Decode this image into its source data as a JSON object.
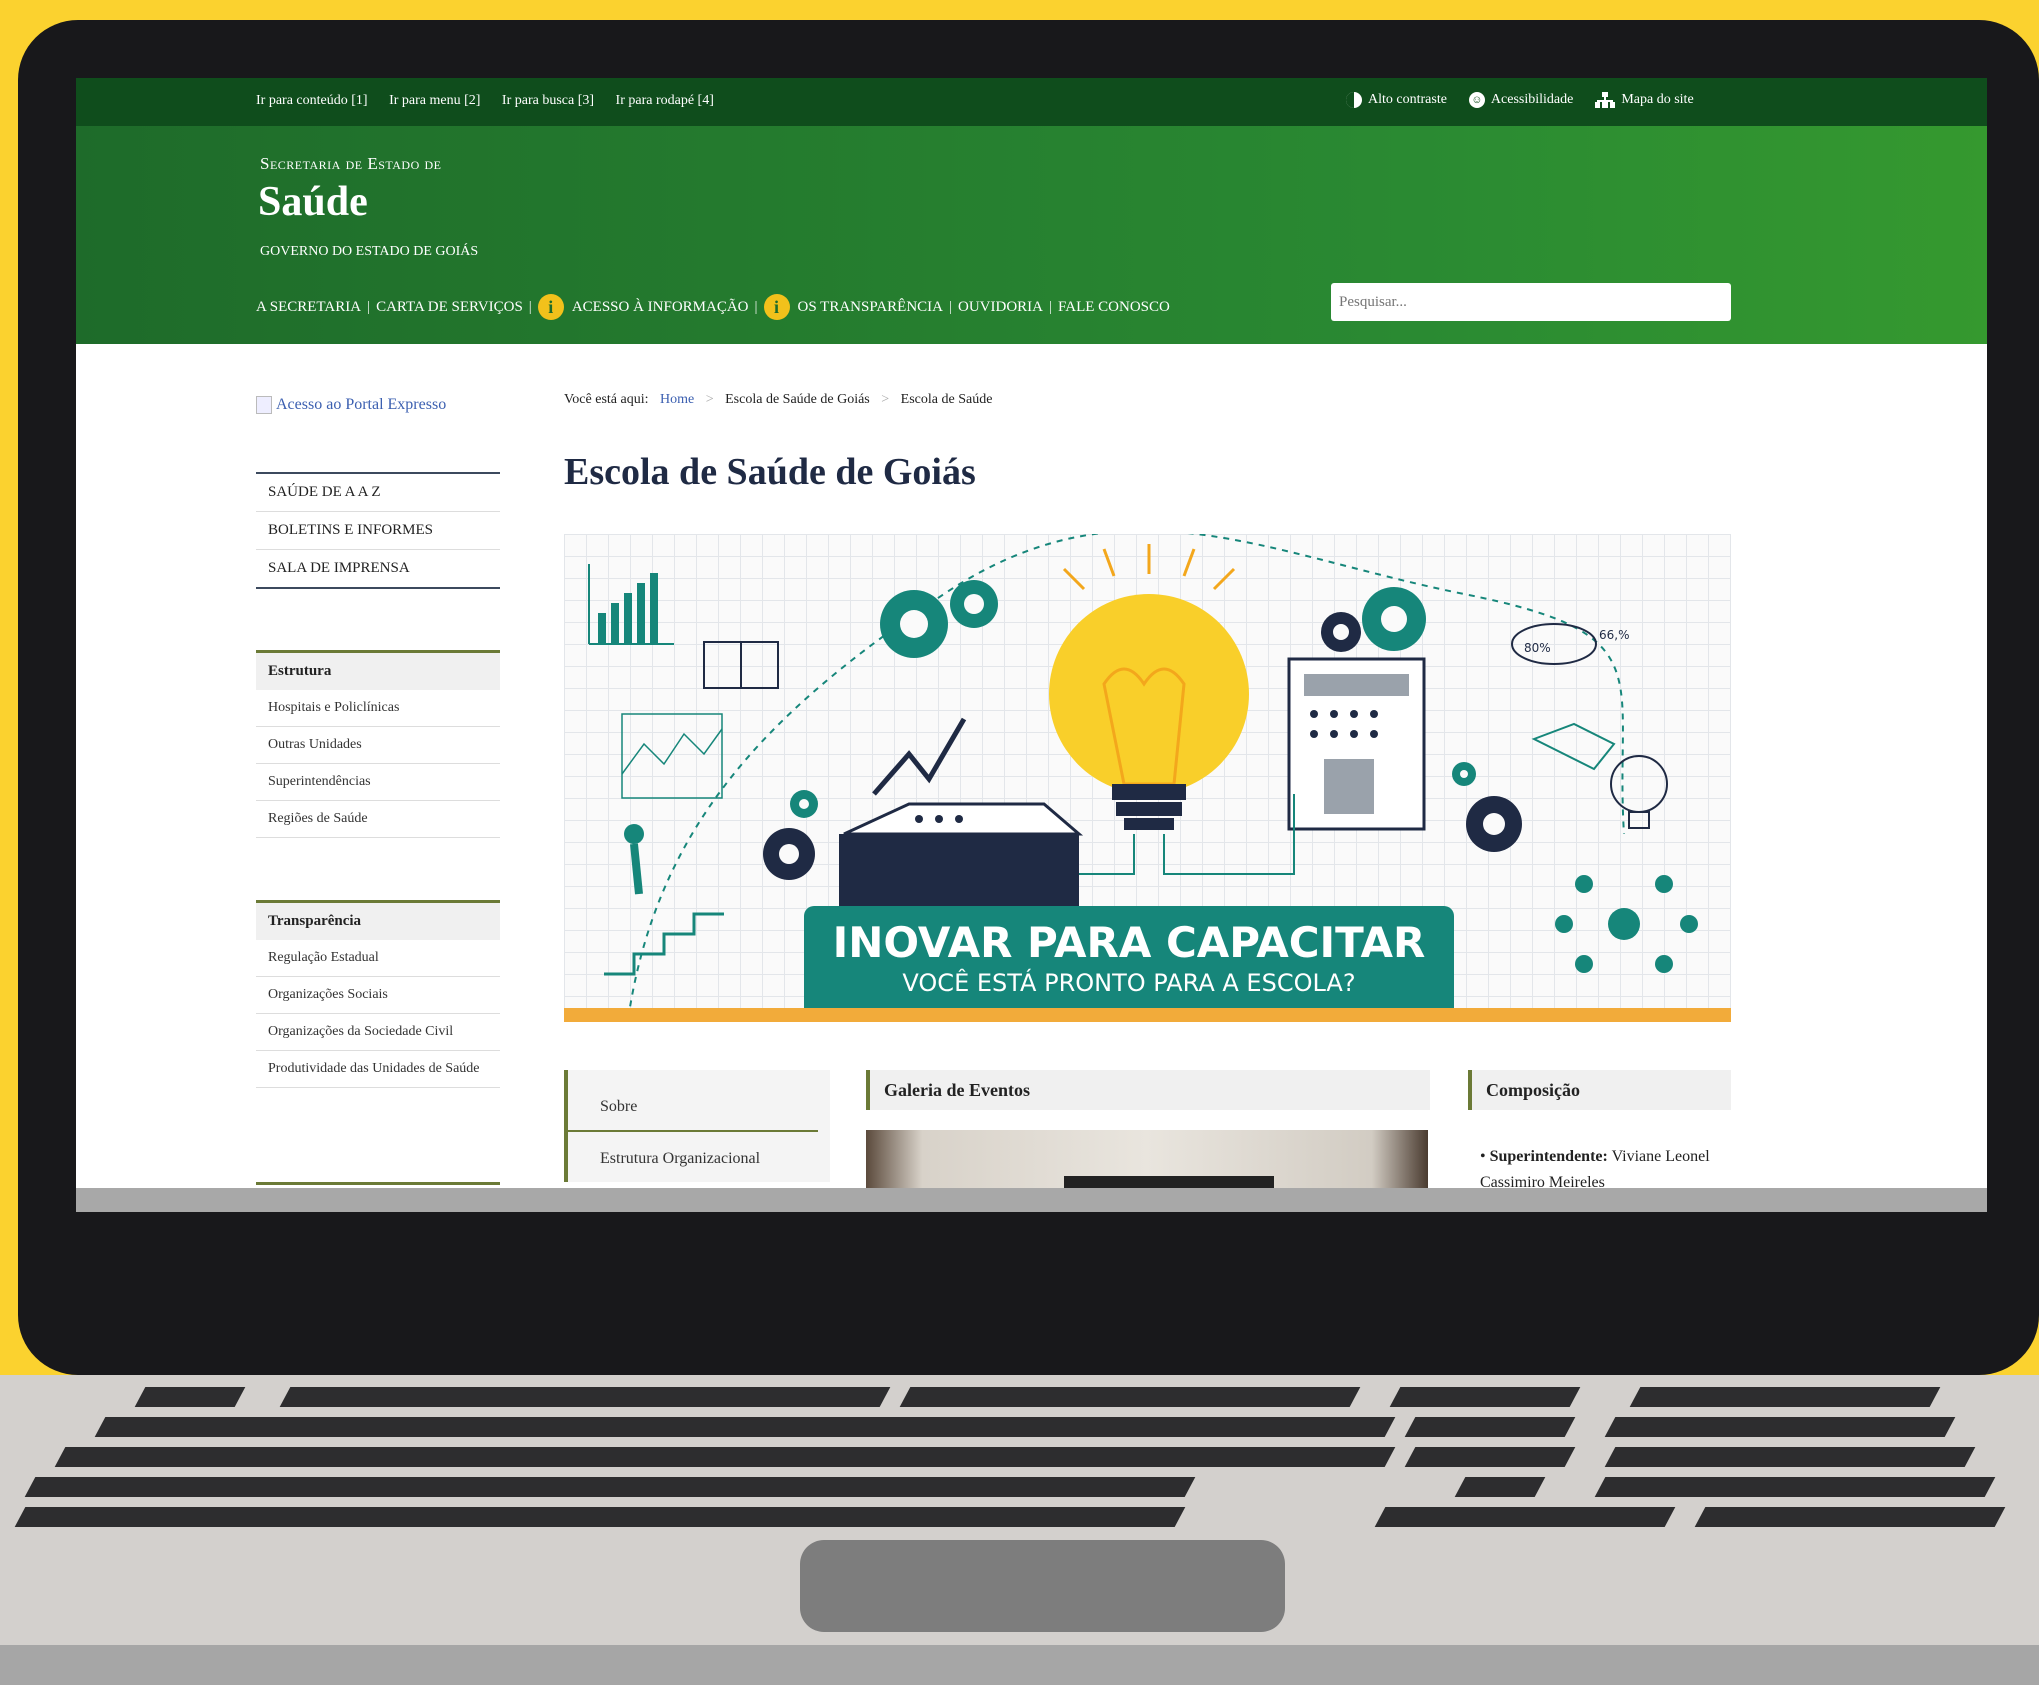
{
  "topbar": {
    "skip_links": [
      "Ir para conteúdo [1]",
      "Ir para menu [2]",
      "Ir para busca [3]",
      "Ir para rodapé [4]"
    ],
    "accessibility": {
      "contrast": "Alto contraste",
      "accessibility": "Acessibilidade",
      "sitemap": "Mapa do site"
    }
  },
  "header": {
    "subtitle": "Secretaria de Estado de",
    "title": "Saúde",
    "government": "GOVERNO DO ESTADO DE GOIÁS",
    "nav": [
      "A SECRETARIA",
      "CARTA DE SERVIÇOS",
      "ACESSO À INFORMAÇÃO",
      "OS TRANSPARÊNCIA",
      "OUVIDORIA",
      "FALE CONOSCO"
    ],
    "search_placeholder": "Pesquisar..."
  },
  "sidebar": {
    "portal_link": "Acesso ao Portal Expresso",
    "menu": [
      "SAÚDE DE A A Z",
      "BOLETINS E INFORMES",
      "SALA DE IMPRENSA"
    ],
    "estrutura": {
      "title": "Estrutura",
      "links": [
        "Hospitais e Policlínicas",
        "Outras Unidades",
        "Superintendências",
        "Regiões de Saúde"
      ]
    },
    "transparencia": {
      "title": "Transparência",
      "links": [
        "Regulação Estadual",
        "Organizações Sociais",
        "Organizações da Sociedade Civil",
        "Produtividade das Unidades de Saúde"
      ]
    }
  },
  "breadcrumb": {
    "prefix": "Você está aqui:",
    "items": [
      "Home",
      "Escola de Saúde de Goiás",
      "Escola de Saúde"
    ]
  },
  "page_title": "Escola de Saúde de Goiás",
  "banner": {
    "headline": "INOVAR PARA CAPACITAR",
    "subline": "VOCÊ ESTÁ PRONTO PARA A ESCOLA?",
    "chart_label_1": "80%",
    "chart_label_2": "66,%"
  },
  "sub_menu": [
    "Sobre",
    "Estrutura Organizacional"
  ],
  "gallery": {
    "title": "Galeria de Eventos"
  },
  "composition": {
    "title": "Composição",
    "role": "Superintendente:",
    "name": "Viviane Leonel Cassimiro Meireles"
  },
  "colors": {
    "header_green": "#2a8a32",
    "topbar_green": "#0f4d1c",
    "title_navy": "#1f2a44",
    "accent_olive": "#6b7a36",
    "banner_teal": "#16867a",
    "banner_orange": "#f2ab3a",
    "background_yellow": "#fbd22f"
  }
}
